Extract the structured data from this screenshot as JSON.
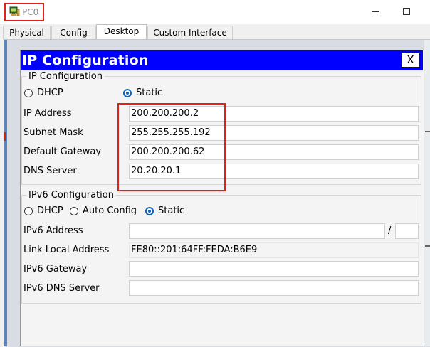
{
  "window": {
    "title": "PC0",
    "icon": "pc-icon"
  },
  "tabs": [
    {
      "label": "Physical"
    },
    {
      "label": "Config"
    },
    {
      "label": "Desktop"
    },
    {
      "label": "Custom Interface"
    }
  ],
  "active_tab": "Desktop",
  "panel": {
    "title": "IP Configuration",
    "close_label": "X"
  },
  "ipv4": {
    "legend": "IP Configuration",
    "dhcp_label": "DHCP",
    "static_label": "Static",
    "selected_mode": "Static",
    "fields": {
      "ip_address": {
        "label": "IP Address",
        "value": "200.200.200.2"
      },
      "subnet_mask": {
        "label": "Subnet Mask",
        "value": "255.255.255.192"
      },
      "default_gateway": {
        "label": "Default Gateway",
        "value": "200.200.200.62"
      },
      "dns_server": {
        "label": "DNS Server",
        "value": "20.20.20.1"
      }
    }
  },
  "ipv6": {
    "legend": "IPv6 Configuration",
    "dhcp_label": "DHCP",
    "auto_label": "Auto Config",
    "static_label": "Static",
    "selected_mode": "Static",
    "fields": {
      "address": {
        "label": "IPv6 Address",
        "value": "",
        "prefix_separator": "/",
        "prefix": ""
      },
      "link_local": {
        "label": "Link Local Address",
        "value": "FE80::201:64FF:FEDA:B6E9"
      },
      "gateway": {
        "label": "IPv6 Gateway",
        "value": ""
      },
      "dns_server": {
        "label": "IPv6 DNS Server",
        "value": ""
      }
    }
  },
  "colors": {
    "panel_header": "#0000ff",
    "highlight": "#e0201b",
    "radio_selected": "#0b62c6"
  }
}
